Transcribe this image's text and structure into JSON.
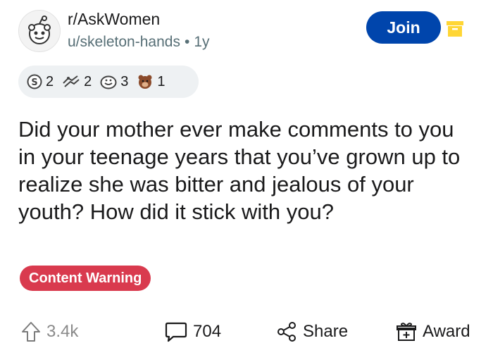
{
  "post": {
    "subreddit": "r/AskWomen",
    "author": "u/skeleton-hands",
    "separator": "•",
    "age": "1y",
    "join_label": "Join",
    "awards": [
      {
        "icon": "silver-award-icon",
        "count": "2"
      },
      {
        "icon": "helpful-award-icon",
        "count": "2"
      },
      {
        "icon": "wholesome-award-icon",
        "count": "3"
      },
      {
        "icon": "bear-award-icon",
        "count": "1"
      }
    ],
    "title": "Did your mother ever make comments to you in your teenage years that you’ve grown up to realize she was bitter and jealous of your youth? How did it stick with you?",
    "content_warning": "Content Warning"
  },
  "actions": {
    "votes": "3.4k",
    "comments": "704",
    "share": "Share",
    "award": "Award"
  },
  "colors": {
    "join": "#0045ac",
    "warning": "#d93a4e",
    "archive": "#ffd635"
  }
}
